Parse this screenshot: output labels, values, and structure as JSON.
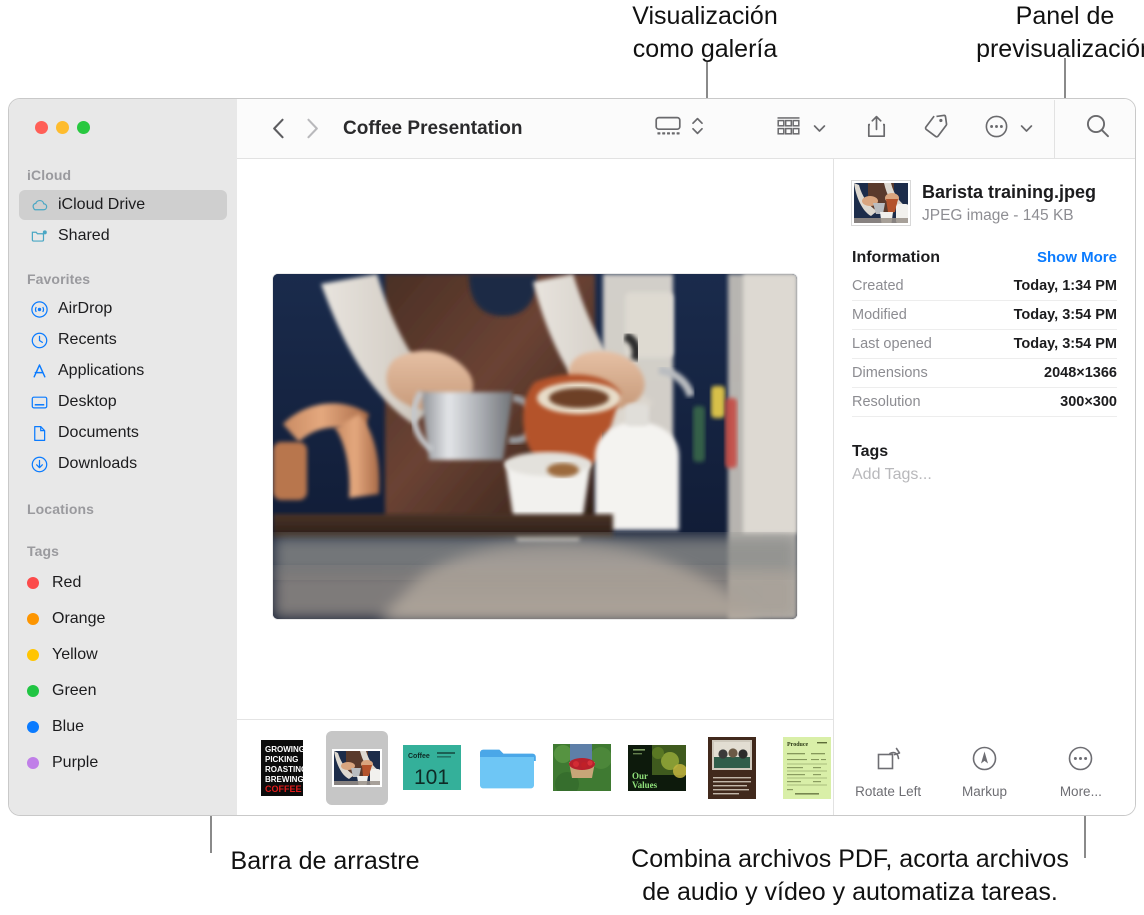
{
  "annotations": {
    "gallery_view": "Visualización\ncomo galería",
    "preview_panel": "Panel de\nprevisualización",
    "drag_bar": "Barra de arrastre",
    "combine": "Combina archivos PDF, acorta archivos\nde audio y vídeo y automatiza tareas."
  },
  "window": {
    "toolbar": {
      "title": "Coffee Presentation",
      "back_icon": "chevron-left-icon",
      "forward_icon": "chevron-right-icon",
      "gallery_view_icon": "gallery-view-icon",
      "view_stepper_icon": "chevron-up-down-icon",
      "group_by_icon": "group-by-icon",
      "group_by_chevron": "chevron-down-icon",
      "share_icon": "share-icon",
      "tag_icon": "tag-icon",
      "more_icon": "ellipsis-circle-icon",
      "more_chevron": "chevron-down-icon",
      "search_icon": "search-icon"
    },
    "sidebar": {
      "sections": [
        {
          "header": "iCloud",
          "items": [
            {
              "label": "iCloud Drive",
              "icon": "icloud-icon",
              "selected": true
            },
            {
              "label": "Shared",
              "icon": "shared-folder-icon",
              "selected": false
            }
          ]
        },
        {
          "header": "Favorites",
          "items": [
            {
              "label": "AirDrop",
              "icon": "airdrop-icon",
              "selected": false
            },
            {
              "label": "Recents",
              "icon": "clock-icon",
              "selected": false
            },
            {
              "label": "Applications",
              "icon": "applications-icon",
              "selected": false
            },
            {
              "label": "Desktop",
              "icon": "desktop-icon",
              "selected": false
            },
            {
              "label": "Documents",
              "icon": "document-icon",
              "selected": false
            },
            {
              "label": "Downloads",
              "icon": "downloads-icon",
              "selected": false
            }
          ]
        },
        {
          "header": "Locations",
          "items": []
        },
        {
          "header": "Tags",
          "tags": [
            {
              "label": "Red",
              "color": "#fc4b4b"
            },
            {
              "label": "Orange",
              "color": "#fd9500"
            },
            {
              "label": "Yellow",
              "color": "#ffc502"
            },
            {
              "label": "Green",
              "color": "#20c543"
            },
            {
              "label": "Blue",
              "color": "#0a7bff"
            },
            {
              "label": "Purple",
              "color": "#c07fe8"
            }
          ]
        }
      ]
    },
    "filmstrip": {
      "thumbnails": [
        {
          "name": "coffee-poster-thumbnail",
          "kind": "poster",
          "selected": false,
          "lines": [
            "GROWING",
            "PICKING",
            "ROASTING",
            "BREWING",
            "COFFEE"
          ]
        },
        {
          "name": "barista-training-thumbnail",
          "kind": "photo-barista",
          "selected": true
        },
        {
          "name": "coffee-101-slide-thumbnail",
          "kind": "slide-101",
          "selected": false,
          "title": "Coffee",
          "number": "101"
        },
        {
          "name": "folder-thumbnail",
          "kind": "folder",
          "selected": false
        },
        {
          "name": "berries-photo-thumbnail",
          "kind": "photo-berries",
          "selected": false
        },
        {
          "name": "our-values-slide-thumbnail",
          "kind": "slide-values",
          "selected": false,
          "lines": [
            "Our",
            "Values"
          ]
        },
        {
          "name": "meeting-document-thumbnail",
          "kind": "doc-meeting",
          "selected": false
        },
        {
          "name": "invoice-document-thumbnail",
          "kind": "doc-invoice",
          "selected": false,
          "title": "Produce"
        }
      ]
    },
    "preview": {
      "file_name": "Barista training.jpeg",
      "file_kind": "JPEG image - 145 KB",
      "information_title": "Information",
      "show_more": "Show More",
      "rows": [
        {
          "key": "Created",
          "value": "Today, 1:34 PM"
        },
        {
          "key": "Modified",
          "value": "Today, 3:54 PM"
        },
        {
          "key": "Last opened",
          "value": "Today, 3:54 PM"
        },
        {
          "key": "Dimensions",
          "value": "2048×1366"
        },
        {
          "key": "Resolution",
          "value": "300×300"
        }
      ],
      "tags_title": "Tags",
      "add_tags_placeholder": "Add Tags...",
      "actions": [
        {
          "label": "Rotate Left",
          "icon": "rotate-left-icon"
        },
        {
          "label": "Markup",
          "icon": "markup-icon"
        },
        {
          "label": "More...",
          "icon": "ellipsis-circle-icon"
        }
      ]
    }
  },
  "colors": {
    "accent_blue": "#0a7bff",
    "sidebar_bg": "#e8e8e8",
    "selected_row": "#cfcfcf",
    "toolbar_bg": "#fbfbfb"
  }
}
